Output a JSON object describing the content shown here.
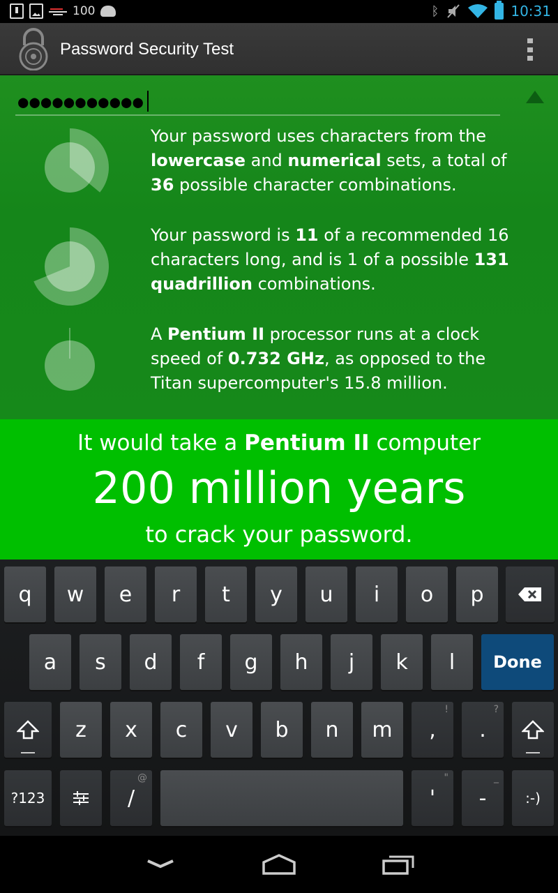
{
  "status_bar": {
    "battery_level": "100",
    "time": "10:31"
  },
  "action_bar": {
    "title": "Password Security Test"
  },
  "password": {
    "masked_value": "●●●●●●●●●●●"
  },
  "info_rows": [
    {
      "parts": [
        {
          "t": "Your password uses characters from the "
        },
        {
          "t": "lowercase",
          "b": true
        },
        {
          "t": " and "
        },
        {
          "t": "numerical",
          "b": true
        },
        {
          "t": " sets, a total of "
        },
        {
          "t": "36",
          "b": true
        },
        {
          "t": " possible character combinations."
        }
      ]
    },
    {
      "parts": [
        {
          "t": "Your password is "
        },
        {
          "t": "11",
          "b": true
        },
        {
          "t": " of a recommended 16 characters long, and is 1 of a possible "
        },
        {
          "t": "131 quadrillion",
          "b": true
        },
        {
          "t": " combinations."
        }
      ]
    },
    {
      "parts": [
        {
          "t": "A "
        },
        {
          "t": "Pentium II",
          "b": true
        },
        {
          "t": " processor runs at a clock speed of "
        },
        {
          "t": "0.732 GHz",
          "b": true
        },
        {
          "t": ", as opposed to the Titan supercomputer's 15.8 million."
        }
      ]
    }
  ],
  "result": {
    "prefix": "It would take a ",
    "processor": "Pentium II",
    "suffix": " computer",
    "duration": "200 million years",
    "closing": "to crack your password."
  },
  "keyboard": {
    "row1": [
      "q",
      "w",
      "e",
      "r",
      "t",
      "y",
      "u",
      "i",
      "o",
      "p"
    ],
    "row2": [
      "a",
      "s",
      "d",
      "f",
      "g",
      "h",
      "j",
      "k",
      "l"
    ],
    "done_label": "Done",
    "row3": [
      "z",
      "x",
      "c",
      "v",
      "b",
      "n",
      "m",
      ",",
      "."
    ],
    "row3_hints": [
      "",
      "",
      "",
      "",
      "",
      "",
      "",
      "!",
      "?"
    ],
    "symbols_label": "?123",
    "slash_label": "/",
    "slash_hint": "@",
    "apostrophe_label": "'",
    "apostrophe_hint": "\"",
    "dash_label": "-",
    "dash_hint": "_",
    "smiley_label": ":-)"
  },
  "icons": {
    "app": "padlock-icon",
    "overflow": "overflow-menu-icon",
    "collapse": "triangle-up-icon",
    "backspace": "backspace-icon",
    "shift": "shift-icon",
    "settings": "sliders-icon",
    "nav_back": "chevron-down-icon",
    "nav_home": "home-icon",
    "nav_recent": "recent-apps-icon"
  },
  "colors": {
    "info_bg": "#17891b",
    "banner_bg": "#00bf00",
    "done_key": "#0e4a7a",
    "accent_blue": "#33b5e5"
  },
  "indicators": {
    "charset_fraction": 0.36,
    "length_fraction": 0.6875,
    "speed_fraction": 0.0
  }
}
